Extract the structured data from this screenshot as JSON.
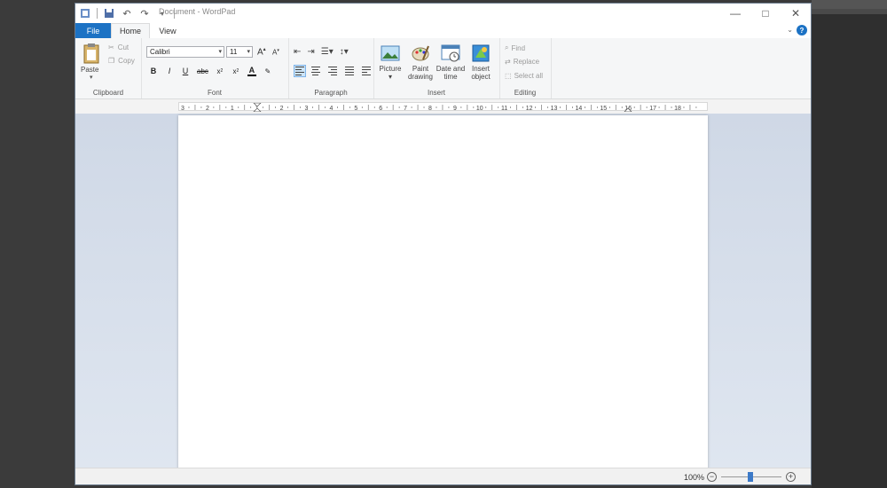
{
  "window": {
    "title": "Document - WordPad"
  },
  "tabs": {
    "file": "File",
    "home": "Home",
    "view": "View"
  },
  "clipboard": {
    "paste": "Paste",
    "cut": "Cut",
    "copy": "Copy",
    "label": "Clipboard"
  },
  "font": {
    "family": "Calibri",
    "size": "11",
    "label": "Font"
  },
  "paragraph": {
    "label": "Paragraph"
  },
  "insert": {
    "picture": "Picture",
    "paint_line1": "Paint",
    "paint_line2": "drawing",
    "date_line1": "Date and",
    "date_line2": "time",
    "object_line1": "Insert",
    "object_line2": "object",
    "label": "Insert"
  },
  "editing": {
    "find": "Find",
    "replace": "Replace",
    "select_all": "Select all",
    "label": "Editing"
  },
  "ruler": {
    "labels": [
      "3",
      "2",
      "1",
      "1",
      "2",
      "3",
      "4",
      "5",
      "6",
      "7",
      "8",
      "9",
      "10",
      "11",
      "12",
      "13",
      "14",
      "15",
      "16",
      "17",
      "18"
    ]
  },
  "status": {
    "zoom": "100%"
  },
  "colors": {
    "accent": "#1c72c4",
    "workspace": "#d4dce8"
  }
}
